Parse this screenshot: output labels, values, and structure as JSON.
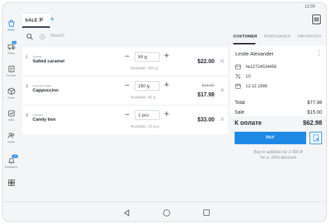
{
  "status": {
    "time": "12:00"
  },
  "tabs": {
    "sale_label": "SALE 1",
    "close_glyph": "✕",
    "add_glyph": "+"
  },
  "sidebar": {
    "items": [
      {
        "label": "Basket",
        "icon": "basket-icon",
        "active": true
      },
      {
        "label": "Pickup",
        "icon": "truck-icon",
        "badge": "20"
      },
      {
        "label": "Pre-order",
        "icon": "preorder-icon"
      },
      {
        "label": "Goods",
        "icon": "box-icon"
      },
      {
        "label": "Sales",
        "icon": "sales-icon"
      },
      {
        "label": "Clients",
        "icon": "people-icon"
      },
      {
        "label": "Notifications",
        "icon": "bell-icon",
        "badge": "100"
      },
      {
        "label": "",
        "icon": "apps-icon"
      }
    ]
  },
  "search": {
    "placeholder": "Search"
  },
  "products": [
    {
      "num": "1",
      "category": "Sweets",
      "name": "Salted caramel",
      "qty": "50 g",
      "available": "Available: 900 g.",
      "price": "$22.00",
      "old_price": ""
    },
    {
      "num": "2",
      "category": "Flavored coffee",
      "name": "Cappuccino",
      "qty": "150 g",
      "available": "Available: 80 g.",
      "price": "$17.98",
      "old_price": "$18.60"
    },
    {
      "num": "3",
      "category": "Candies",
      "name": "Candy box",
      "qty": "1 pcs",
      "available": "Available: 20 pcs.",
      "price": "$33.00",
      "old_price": ""
    }
  ],
  "customer_tabs": {
    "customer": "CUSTOMER",
    "purchases": "PURCHASES",
    "favorites": "FAVORITES"
  },
  "customer": {
    "name": "Leslie Alexander",
    "card": "№12724534456",
    "discount": "10",
    "birthday": "12.12.1998"
  },
  "totals": {
    "total_label": "Total",
    "total_value": "$77.98",
    "sale_label": "Sale",
    "sale_value": "$15.00",
    "grand_label": "К оплате",
    "grand_value": "$62.98"
  },
  "pay": {
    "label": "PAY"
  },
  "promo": {
    "line1": "Buy in addition for 2 000 ₽",
    "line2": "for a -20% discount"
  },
  "colors": {
    "accent": "#1e88e5",
    "text": "#1f2430",
    "muted": "#8a8f98"
  }
}
